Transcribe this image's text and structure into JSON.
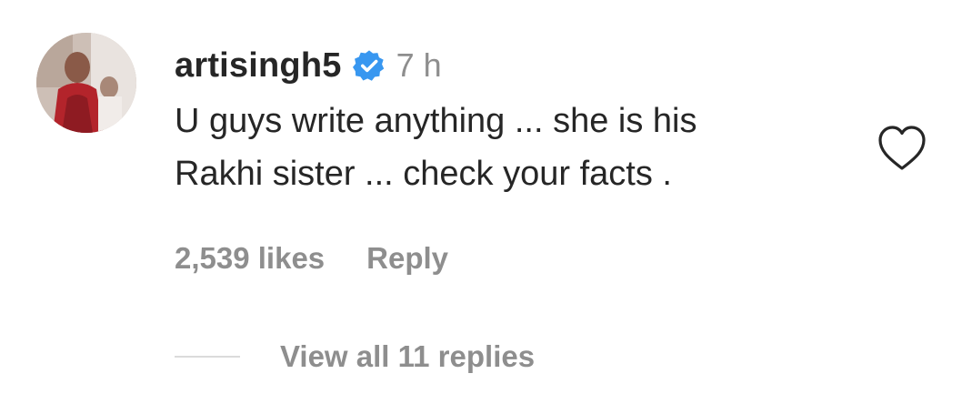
{
  "comment": {
    "username": "artisingh5",
    "verified_icon": "verified-badge-icon",
    "verified_color": "#3897f0",
    "time": "7 h",
    "text_lines": [
      "U guys write anything ... she is his",
      "Rakhi sister ... check your facts ."
    ],
    "likes": "2,539 likes",
    "reply_label": "Reply",
    "like_icon": "heart-outline-icon",
    "view_replies": "View all 11 replies"
  }
}
